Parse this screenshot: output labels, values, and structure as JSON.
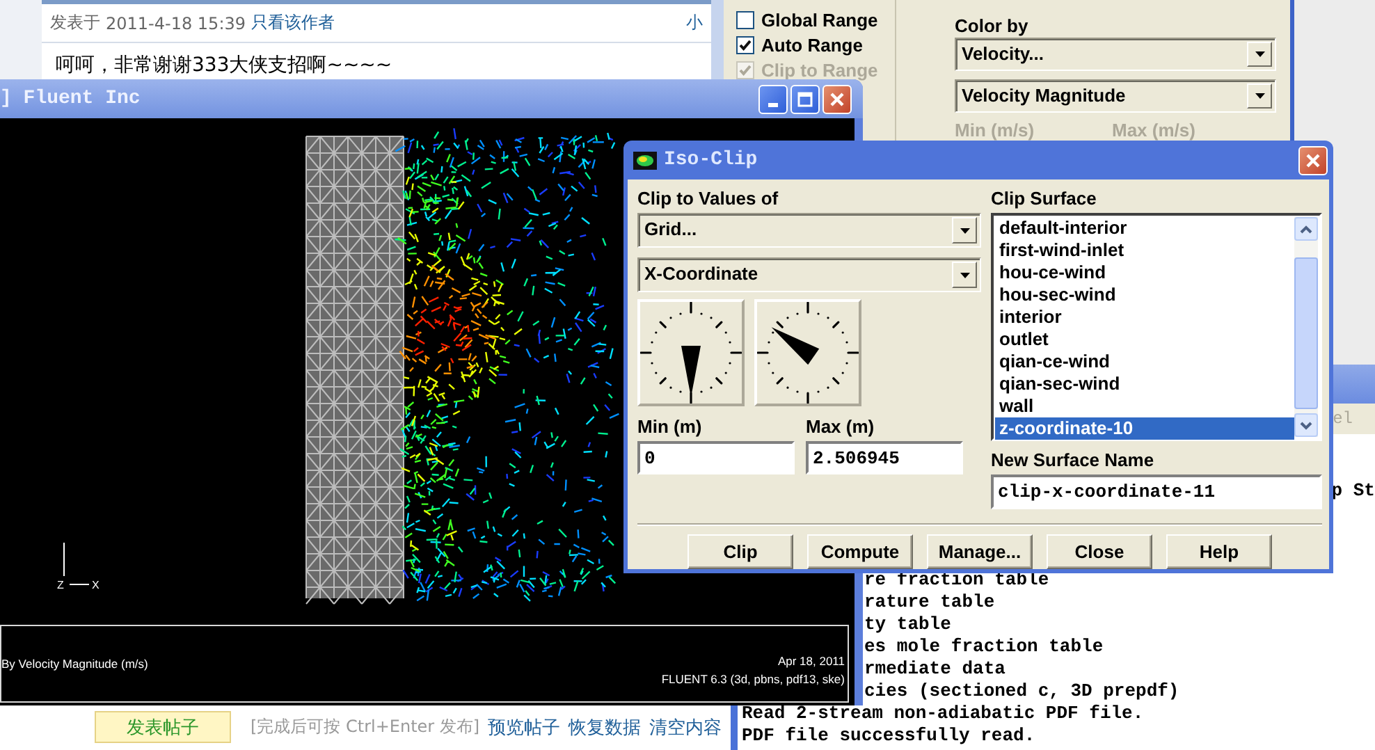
{
  "forum": {
    "post_meta": {
      "prefix": "发表于",
      "timestamp": "2011-4-18 15:39",
      "author_filter": "只看该作者",
      "font_size": "小"
    },
    "post_text": "呵呵，非常谢谢333大侠支招啊~~~~",
    "reply_bar": {
      "submit": "发表帖子",
      "hint": "[完成后可按 Ctrl+Enter 发布]",
      "links": [
        "预览帖子",
        "恢复数据",
        "清空内容"
      ]
    }
  },
  "display_panel": {
    "checkboxes": [
      {
        "label": "Global Range",
        "checked": false,
        "disabled": false
      },
      {
        "label": "Auto Range",
        "checked": true,
        "disabled": false
      },
      {
        "label": "Clip to Range",
        "checked": true,
        "disabled": true
      }
    ],
    "color_by": {
      "label": "Color by",
      "dropdowns": [
        "Velocity...",
        "Velocity Magnitude"
      ]
    },
    "range_labels": [
      "Min (m/s)",
      "Max (m/s)"
    ]
  },
  "graphics_window": {
    "title": "] Fluent Inc",
    "axis_labels": [
      "Z",
      "X"
    ],
    "legend": {
      "caption": "By Velocity Magnitude (m/s)",
      "date": "Apr 18, 2011",
      "version": "FLUENT 6.3 (3d, pbns, pdf13, ske)"
    }
  },
  "console": {
    "toolbar_text": "el",
    "upper_lines": [
      "p St"
    ],
    "lower_lines": [
      {
        "text": "re fraction table",
        "kind": "tail"
      },
      {
        "text": "rature table",
        "kind": "tail"
      },
      {
        "text": "ty table",
        "kind": "tail"
      },
      {
        "text": "es mole fraction table",
        "kind": "tail"
      },
      {
        "text": "rmediate data",
        "kind": "tail"
      },
      {
        "text": "cies (sectioned c, 3D prepdf)",
        "kind": "tail"
      },
      {
        "text": "Read 2-stream non-adiabatic PDF file.",
        "kind": "full"
      },
      {
        "text": "PDF file successfully read.",
        "kind": "full"
      }
    ]
  },
  "iso_clip": {
    "title": "Iso-Clip",
    "clip_to_values_of": {
      "label": "Clip to Values of",
      "dropdowns": [
        "Grid...",
        "X-Coordinate"
      ]
    },
    "min": {
      "label": "Min (m)",
      "value": "0"
    },
    "max": {
      "label": "Max (m)",
      "value": "2.506945"
    },
    "clip_surface": {
      "label": "Clip Surface",
      "items": [
        {
          "label": "default-interior",
          "selected": false
        },
        {
          "label": "first-wind-inlet",
          "selected": false
        },
        {
          "label": "hou-ce-wind",
          "selected": false
        },
        {
          "label": "hou-sec-wind",
          "selected": false
        },
        {
          "label": "interior",
          "selected": false
        },
        {
          "label": "outlet",
          "selected": false
        },
        {
          "label": "qian-ce-wind",
          "selected": false
        },
        {
          "label": "qian-sec-wind",
          "selected": false
        },
        {
          "label": "wall",
          "selected": false
        },
        {
          "label": "z-coordinate-10",
          "selected": true
        }
      ]
    },
    "new_surface_name": {
      "label": "New Surface Name",
      "value": "clip-x-coordinate-11"
    },
    "buttons": [
      "Clip",
      "Compute",
      "Manage...",
      "Close",
      "Help"
    ]
  }
}
